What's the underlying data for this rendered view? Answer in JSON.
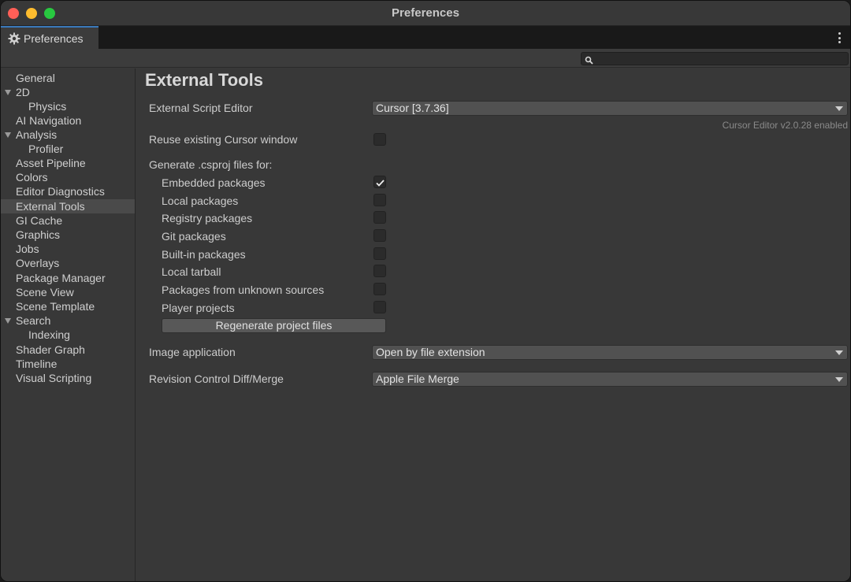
{
  "window": {
    "title": "Preferences"
  },
  "tab": {
    "label": "Preferences",
    "icon": "gear-icon"
  },
  "search": {
    "placeholder": "",
    "value": ""
  },
  "sidebar": {
    "items": [
      {
        "label": "General",
        "indent": 0,
        "expandable": false
      },
      {
        "label": "2D",
        "indent": 0,
        "expandable": true
      },
      {
        "label": "Physics",
        "indent": 1,
        "expandable": false
      },
      {
        "label": "AI Navigation",
        "indent": 0,
        "expandable": false
      },
      {
        "label": "Analysis",
        "indent": 0,
        "expandable": true
      },
      {
        "label": "Profiler",
        "indent": 1,
        "expandable": false
      },
      {
        "label": "Asset Pipeline",
        "indent": 0,
        "expandable": false
      },
      {
        "label": "Colors",
        "indent": 0,
        "expandable": false
      },
      {
        "label": "Editor Diagnostics",
        "indent": 0,
        "expandable": false
      },
      {
        "label": "External Tools",
        "indent": 0,
        "expandable": false,
        "selected": true
      },
      {
        "label": "GI Cache",
        "indent": 0,
        "expandable": false
      },
      {
        "label": "Graphics",
        "indent": 0,
        "expandable": false
      },
      {
        "label": "Jobs",
        "indent": 0,
        "expandable": false
      },
      {
        "label": "Overlays",
        "indent": 0,
        "expandable": false
      },
      {
        "label": "Package Manager",
        "indent": 0,
        "expandable": false
      },
      {
        "label": "Scene View",
        "indent": 0,
        "expandable": false
      },
      {
        "label": "Scene Template",
        "indent": 0,
        "expandable": false
      },
      {
        "label": "Search",
        "indent": 0,
        "expandable": true
      },
      {
        "label": "Indexing",
        "indent": 1,
        "expandable": false
      },
      {
        "label": "Shader Graph",
        "indent": 0,
        "expandable": false
      },
      {
        "label": "Timeline",
        "indent": 0,
        "expandable": false
      },
      {
        "label": "Visual Scripting",
        "indent": 0,
        "expandable": false
      }
    ]
  },
  "main": {
    "title": "External Tools",
    "script_editor": {
      "label": "External Script Editor",
      "value": "Cursor [3.7.36]",
      "hint": "Cursor Editor v2.0.28 enabled"
    },
    "reuse_window": {
      "label": "Reuse existing Cursor window",
      "checked": false
    },
    "generate_label": "Generate .csproj files for:",
    "csproj_options": [
      {
        "label": "Embedded packages",
        "checked": true
      },
      {
        "label": "Local packages",
        "checked": false
      },
      {
        "label": "Registry packages",
        "checked": false
      },
      {
        "label": "Git packages",
        "checked": false
      },
      {
        "label": "Built-in packages",
        "checked": false
      },
      {
        "label": "Local tarball",
        "checked": false
      },
      {
        "label": "Packages from unknown sources",
        "checked": false
      },
      {
        "label": "Player projects",
        "checked": false
      }
    ],
    "regenerate_button": "Regenerate project files",
    "image_application": {
      "label": "Image application",
      "value": "Open by file extension"
    },
    "revision_control": {
      "label": "Revision Control Diff/Merge",
      "value": "Apple File Merge"
    }
  },
  "colors": {
    "accent": "#3a79bb",
    "close": "#ff5f57",
    "minimize": "#febc2e",
    "maximize": "#28c840"
  }
}
